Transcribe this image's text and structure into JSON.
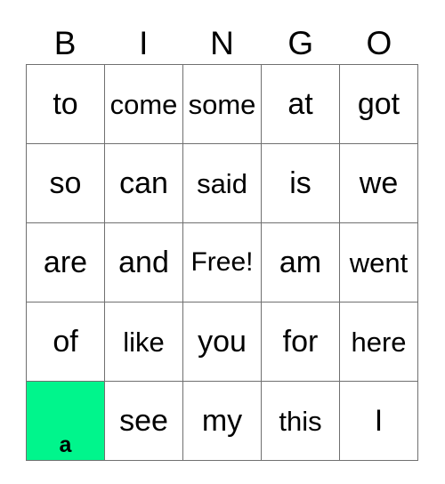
{
  "card": {
    "header_letters": [
      "B",
      "I",
      "N",
      "G",
      "O"
    ],
    "marked_color": "#00F58C",
    "border_color": "#707070",
    "rows": [
      [
        {
          "text": "to",
          "marked": false
        },
        {
          "text": "come",
          "marked": false
        },
        {
          "text": "some",
          "marked": false
        },
        {
          "text": "at",
          "marked": false
        },
        {
          "text": "got",
          "marked": false
        }
      ],
      [
        {
          "text": "so",
          "marked": false
        },
        {
          "text": "can",
          "marked": false
        },
        {
          "text": "said",
          "marked": false
        },
        {
          "text": "is",
          "marked": false
        },
        {
          "text": "we",
          "marked": false
        }
      ],
      [
        {
          "text": "are",
          "marked": false
        },
        {
          "text": "and",
          "marked": false
        },
        {
          "text": "Free!",
          "marked": false
        },
        {
          "text": "am",
          "marked": false
        },
        {
          "text": "went",
          "marked": false
        }
      ],
      [
        {
          "text": "of",
          "marked": false
        },
        {
          "text": "like",
          "marked": false
        },
        {
          "text": "you",
          "marked": false
        },
        {
          "text": "for",
          "marked": false
        },
        {
          "text": "here",
          "marked": false
        }
      ],
      [
        {
          "text": "a",
          "marked": true
        },
        {
          "text": "see",
          "marked": false
        },
        {
          "text": "my",
          "marked": false
        },
        {
          "text": "this",
          "marked": false
        },
        {
          "text": "I",
          "marked": false
        }
      ]
    ]
  }
}
